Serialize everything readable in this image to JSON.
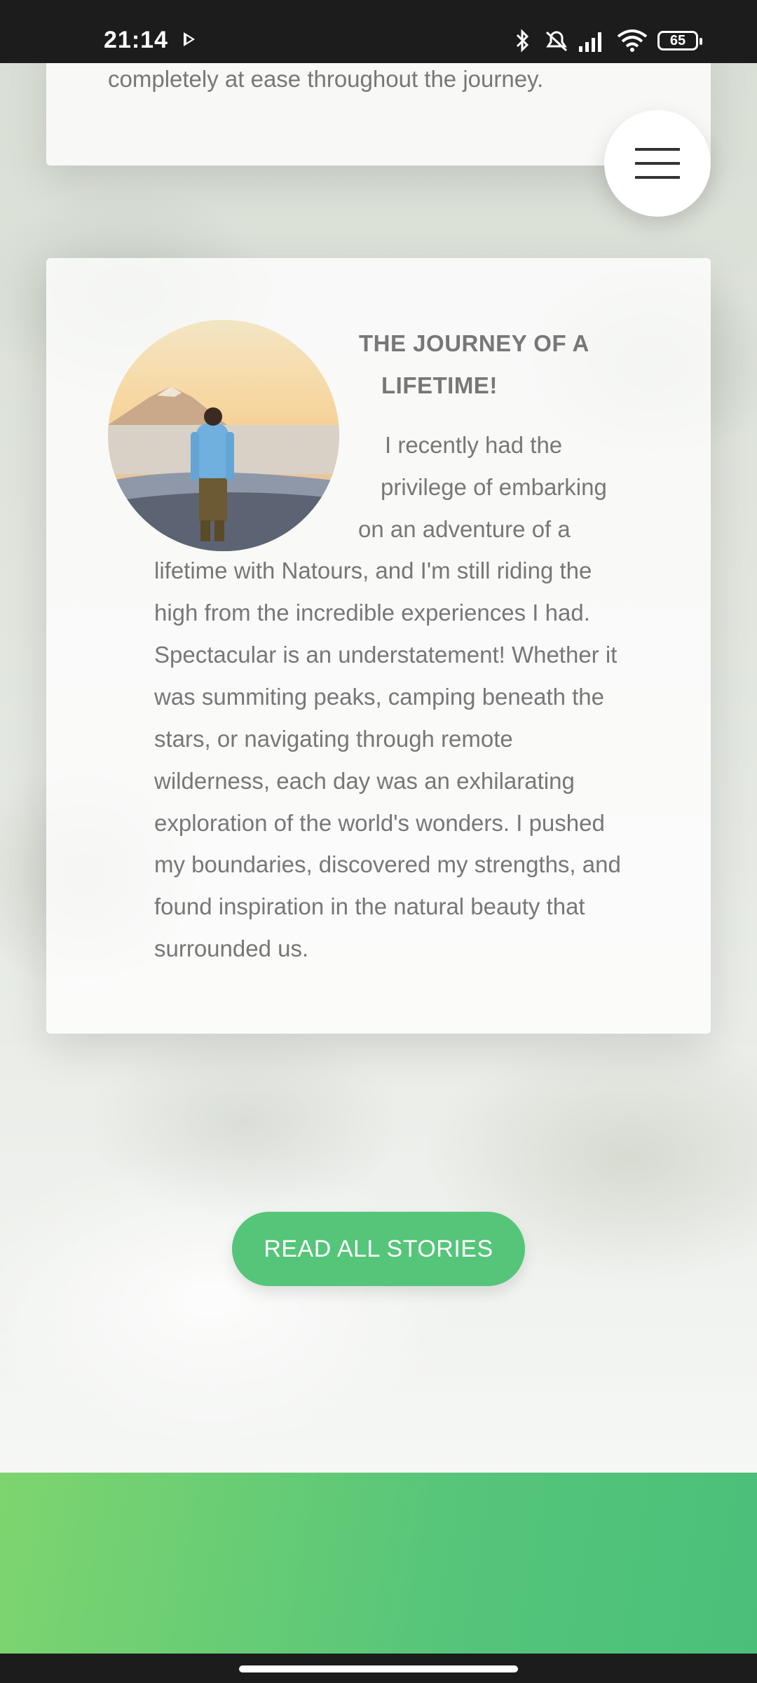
{
  "status_bar": {
    "time": "21:14",
    "battery": "65",
    "icons": [
      "play-icon",
      "bluetooth-icon",
      "alarm-off-icon",
      "signal-icon",
      "wifi-icon",
      "battery-icon"
    ]
  },
  "previous_story": {
    "last_line": "completely at ease throughout the journey."
  },
  "menu": {
    "icon": "hamburger-menu-icon"
  },
  "story": {
    "heading_line1": "THE JOURNEY OF A",
    "heading_line2": "LIFETIME!",
    "lines": [
      "I recently had the",
      "privilege of embarking",
      "on an adventure of a",
      "lifetime with Natours, and I'm still riding the",
      "high from the incredible experiences I had.",
      "Spectacular is an understatement! Whether it",
      "was summiting peaks, camping beneath the",
      "stars, or navigating through remote",
      "wilderness, each day was an exhilarating",
      "exploration of the world's wonders. I pushed",
      "my boundaries, discovered my strengths, and",
      "found inspiration in the natural beauty that",
      "surrounded us."
    ],
    "image": "hiker-mountain-sunrise-photo"
  },
  "cta": {
    "label": "READ ALL STORIES"
  },
  "colors": {
    "primary": "#55c57a",
    "primary_light": "#7ed56f",
    "text": "#777777"
  }
}
